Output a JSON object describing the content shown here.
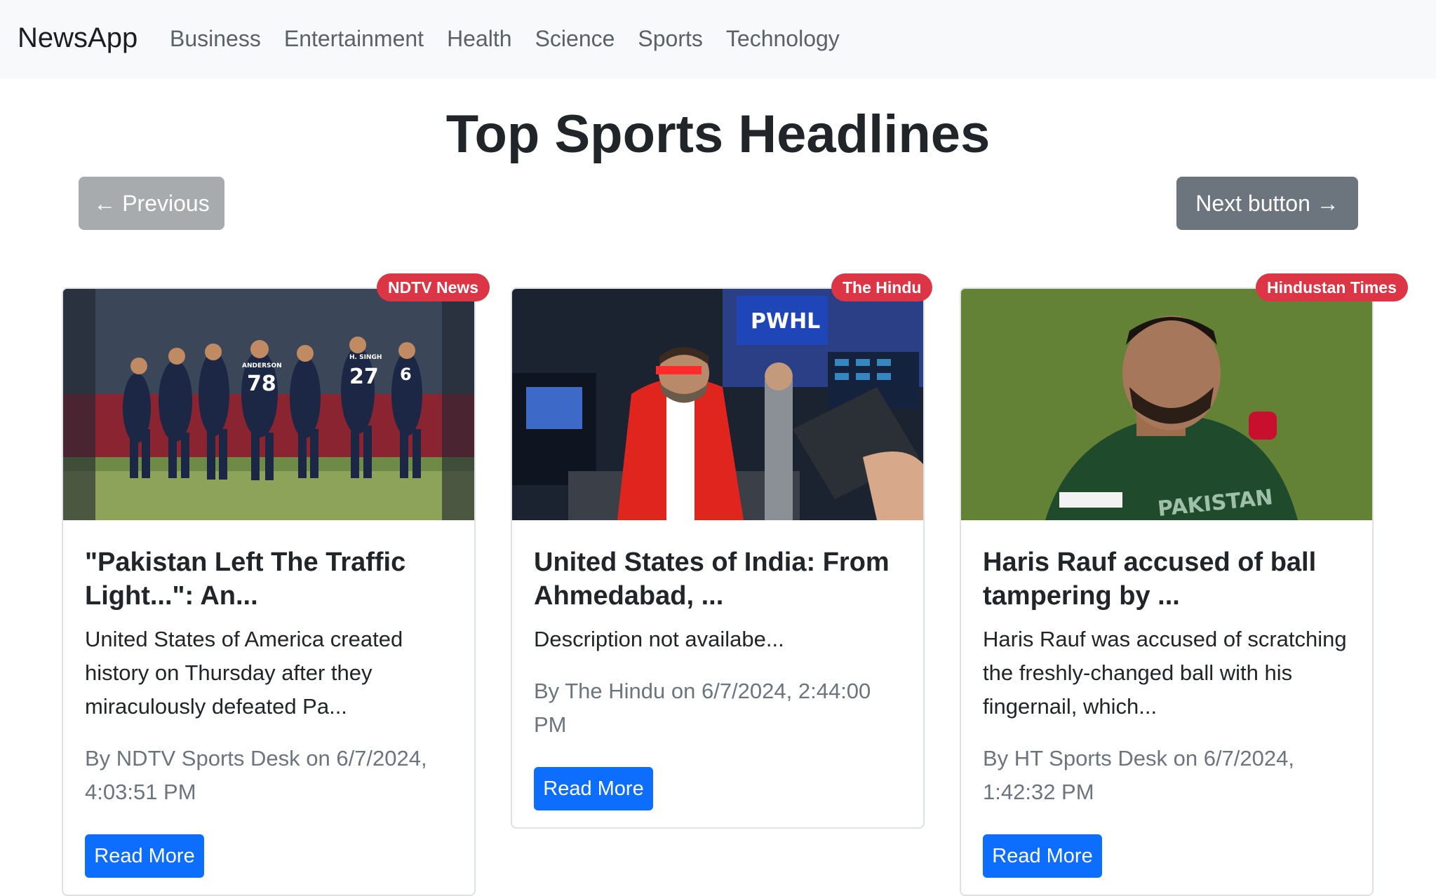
{
  "navbar": {
    "brand": "NewsApp",
    "links": [
      "Business",
      "Entertainment",
      "Health",
      "Science",
      "Sports",
      "Technology"
    ]
  },
  "page": {
    "title": "Top Sports Headlines",
    "prev_label": "← Previous",
    "next_label": "Next button →"
  },
  "cards": [
    {
      "source": "NDTV News",
      "title_line1": "\"Pakistan Left The Traffic",
      "title_line2": "Light...\": An...",
      "desc_line1": "United States of America created",
      "desc_line2": "history on Thursday after they",
      "desc_line3": "miraculously defeated Pa...",
      "meta_line1": "By NDTV Sports Desk on 6/7/2024,",
      "meta_line2": "4:03:51 PM",
      "button": "Read More",
      "jersey_numbers": [
        "78",
        "27",
        "6"
      ],
      "jersey_names": [
        "ANDERSON",
        "H. SINGH"
      ]
    },
    {
      "source": "The Hindu",
      "title_line1": "United States of India: From",
      "title_line2": "Ahmedabad, ...",
      "desc_line1": "Description not availabe...",
      "meta_line1": "By The Hindu on 6/7/2024, 2:44:00",
      "meta_line2": "PM",
      "button": "Read More",
      "sign_text": "PWHL"
    },
    {
      "source": "Hindustan Times",
      "title_line1": "Haris Rauf accused of ball",
      "title_line2": "tampering by ...",
      "desc_line1": "Haris Rauf was accused of scratching",
      "desc_line2": "the freshly-changed ball with his",
      "desc_line3": "fingernail, which...",
      "meta_line1": "By HT Sports Desk on 6/7/2024,",
      "meta_line2": "1:42:32 PM",
      "button": "Read More",
      "shirt_text": "PAKISTAN"
    }
  ],
  "colors": {
    "navbar_bg": "#f8f9fa",
    "badge": "#dc3545",
    "primary": "#0d6efd",
    "secondary": "#6c757d"
  }
}
